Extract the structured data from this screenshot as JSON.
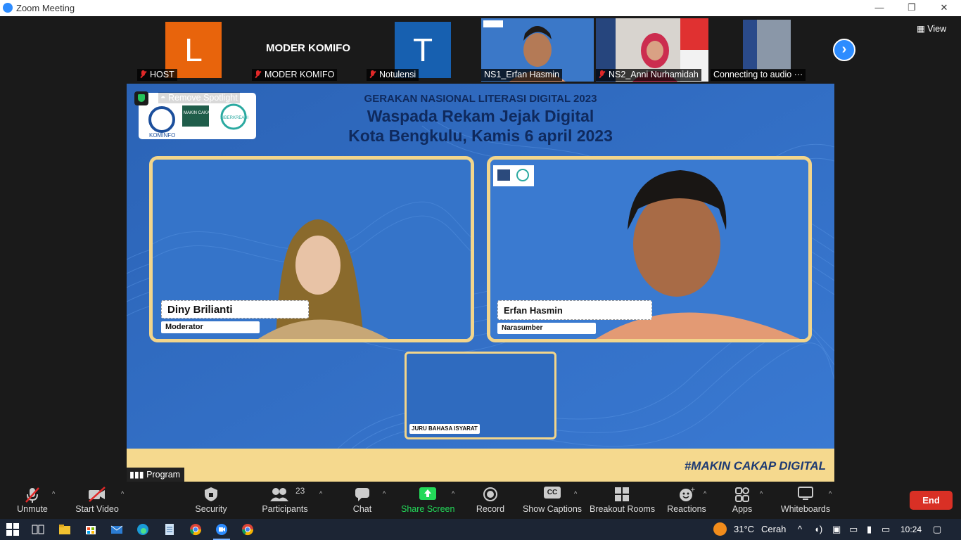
{
  "window": {
    "title": "Zoom Meeting",
    "minimize": "—",
    "restore": "❐",
    "close": "✕"
  },
  "strip": {
    "tiles": [
      {
        "avatar_letter": "L",
        "avatar_color": "#e8640c",
        "label": "HOST"
      },
      {
        "big_name": "MODER KOMIFO",
        "label": "MODER KOMIFO"
      },
      {
        "avatar_letter": "T",
        "avatar_color": "#1760b0",
        "label": "Notulensi"
      },
      {
        "label": "NS1_Erfan Hasmin"
      },
      {
        "label": "NS2_Anni Nurhamidah"
      },
      {
        "label": "Connecting to audio ···"
      }
    ],
    "view_label": "View"
  },
  "stage": {
    "spotlight_label": "Remove Spotlight",
    "heading1": "GERAKAN NASIONAL LITERASI DIGITAL 2023",
    "heading2": "Waspada Rekam Jejak Digital",
    "heading3": "Kota Bengkulu, Kamis 6 april 2023",
    "logos": [
      "KOMINFO",
      "MAKIN CAKAP DIGITAL",
      "SIBERKREASI"
    ],
    "left_name": "Diny Brilianti",
    "left_role": "Moderator",
    "right_name": "Erfan Hasmin",
    "right_role": "Narasumber",
    "interpreter_label": "JURU BAHASA ISYARAT",
    "hashtag": "#MAKIN CAKAP DIGITAL",
    "program_label": "Program"
  },
  "toolbar": {
    "unmute": "Unmute",
    "start_video": "Start Video",
    "security": "Security",
    "participants": "Participants",
    "participants_count": "23",
    "chat": "Chat",
    "share_screen": "Share Screen",
    "record": "Record",
    "show_captions": "Show Captions",
    "captions_icon": "CC",
    "breakout_rooms": "Breakout Rooms",
    "reactions": "Reactions",
    "apps": "Apps",
    "whiteboards": "Whiteboards",
    "end": "End"
  },
  "taskbar": {
    "weather_temp": "31°C",
    "weather_text": "Cerah",
    "time": "10:24"
  },
  "colors": {
    "zoom_blue": "#2d8cff",
    "end_red": "#d93025",
    "share_green": "#23d959",
    "frame_gold": "#f2d58b"
  }
}
